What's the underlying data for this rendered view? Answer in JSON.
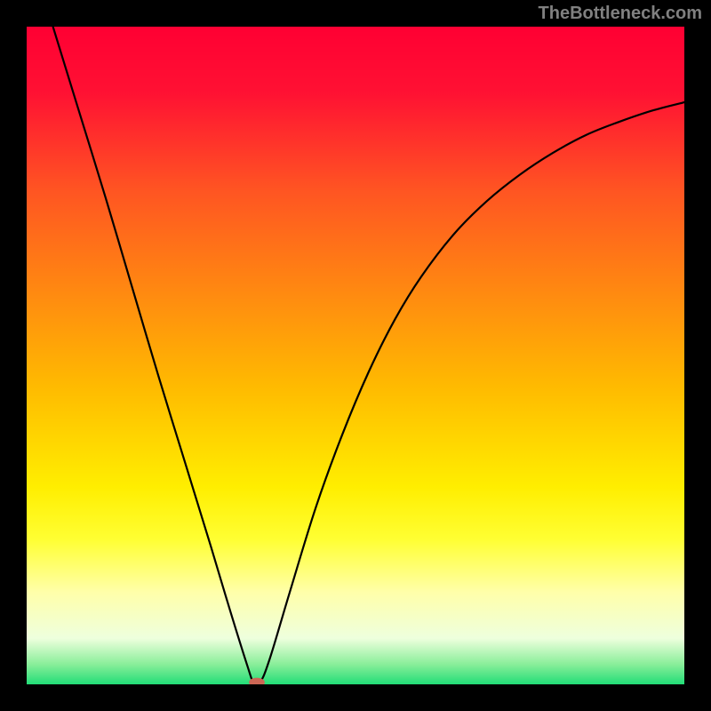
{
  "watermark": "TheBottleneck.com",
  "chart_data": {
    "type": "line",
    "title": "",
    "xlabel": "",
    "ylabel": "",
    "xlim": [
      0,
      100
    ],
    "ylim": [
      0,
      100
    ],
    "background_gradient": {
      "stops": [
        {
          "offset": 0.0,
          "color": "#ff0033"
        },
        {
          "offset": 0.1,
          "color": "#ff1133"
        },
        {
          "offset": 0.25,
          "color": "#ff5522"
        },
        {
          "offset": 0.4,
          "color": "#ff8811"
        },
        {
          "offset": 0.55,
          "color": "#ffbb00"
        },
        {
          "offset": 0.7,
          "color": "#ffee00"
        },
        {
          "offset": 0.78,
          "color": "#ffff33"
        },
        {
          "offset": 0.86,
          "color": "#ffffaa"
        },
        {
          "offset": 0.93,
          "color": "#eeffdd"
        },
        {
          "offset": 0.97,
          "color": "#88ee99"
        },
        {
          "offset": 1.0,
          "color": "#22dd77"
        }
      ]
    },
    "series": [
      {
        "name": "bottleneck-curve",
        "type": "line",
        "color": "#000000",
        "points": [
          {
            "x": 4.0,
            "y": 100.0
          },
          {
            "x": 8.0,
            "y": 87.0
          },
          {
            "x": 12.0,
            "y": 74.0
          },
          {
            "x": 16.0,
            "y": 60.5
          },
          {
            "x": 20.0,
            "y": 47.0
          },
          {
            "x": 24.0,
            "y": 34.0
          },
          {
            "x": 28.0,
            "y": 21.0
          },
          {
            "x": 31.0,
            "y": 11.0
          },
          {
            "x": 33.5,
            "y": 3.0
          },
          {
            "x": 34.5,
            "y": 0.3
          },
          {
            "x": 35.5,
            "y": 0.3
          },
          {
            "x": 37.0,
            "y": 4.0
          },
          {
            "x": 40.0,
            "y": 14.0
          },
          {
            "x": 44.0,
            "y": 27.0
          },
          {
            "x": 48.0,
            "y": 38.0
          },
          {
            "x": 52.0,
            "y": 47.5
          },
          {
            "x": 56.0,
            "y": 55.5
          },
          {
            "x": 60.0,
            "y": 62.0
          },
          {
            "x": 65.0,
            "y": 68.5
          },
          {
            "x": 70.0,
            "y": 73.5
          },
          {
            "x": 75.0,
            "y": 77.5
          },
          {
            "x": 80.0,
            "y": 80.8
          },
          {
            "x": 85.0,
            "y": 83.5
          },
          {
            "x": 90.0,
            "y": 85.5
          },
          {
            "x": 95.0,
            "y": 87.2
          },
          {
            "x": 100.0,
            "y": 88.5
          }
        ]
      }
    ],
    "marker": {
      "name": "optimal-point",
      "x": 35.0,
      "y": 0.3,
      "color": "#cc6655",
      "rx": 1.2,
      "ry": 0.7
    }
  }
}
